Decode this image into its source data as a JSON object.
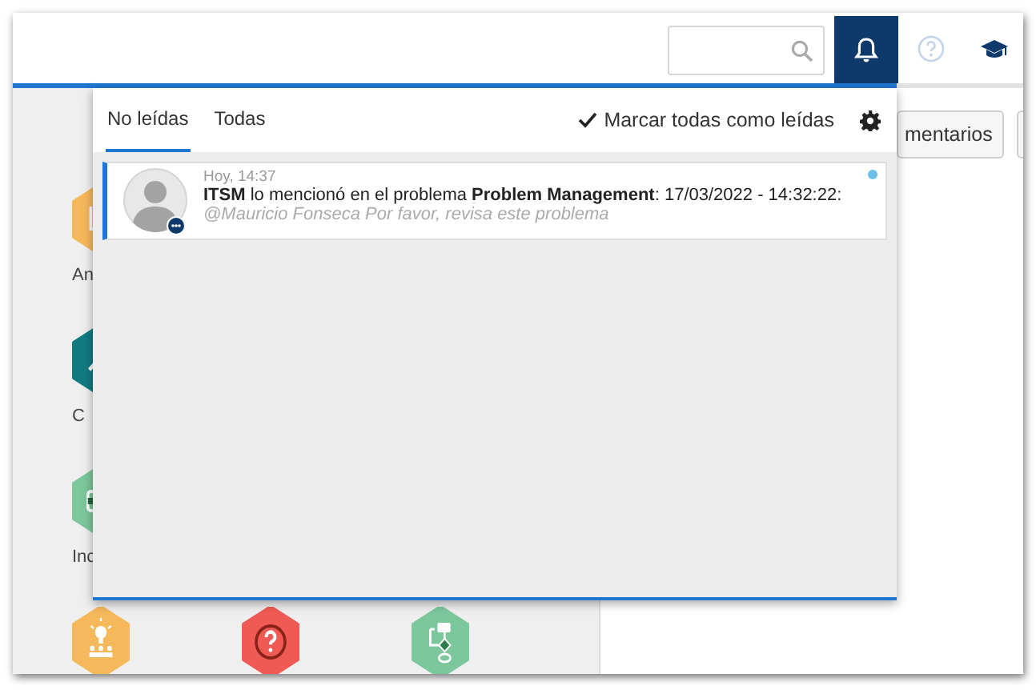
{
  "header": {
    "notifications_button": {
      "active": true
    }
  },
  "tile_rows": [
    [
      {
        "label": "An",
        "kind": "chart",
        "color": "#f5b85a"
      }
    ],
    [
      {
        "label": "C",
        "kind": "wrench",
        "color": "#137a82"
      }
    ],
    [
      {
        "label": "Inc",
        "kind": "card",
        "color": "#7cc79c"
      }
    ],
    [
      {
        "kind": "idea",
        "color": "#f5b85a"
      },
      {
        "kind": "question",
        "color": "#f05a55"
      },
      {
        "kind": "flow",
        "color": "#7cc79c"
      }
    ]
  ],
  "toolbar_buttons": [
    "mentarios"
  ],
  "notifications": {
    "tabs": [
      {
        "label": "No leídas",
        "selected": true
      },
      {
        "label": "Todas",
        "selected": false
      }
    ],
    "mark_all": "Marcar todas como leídas",
    "items": [
      {
        "time": "Hoy, 14:37",
        "message": "**ITSM** lo mencionó en el problema **Problem Management**: 17/03/2022 - 14:32:22:",
        "comment": "@Mauricio Fonseca Por favor, revisa este problema",
        "unread": true
      }
    ]
  }
}
